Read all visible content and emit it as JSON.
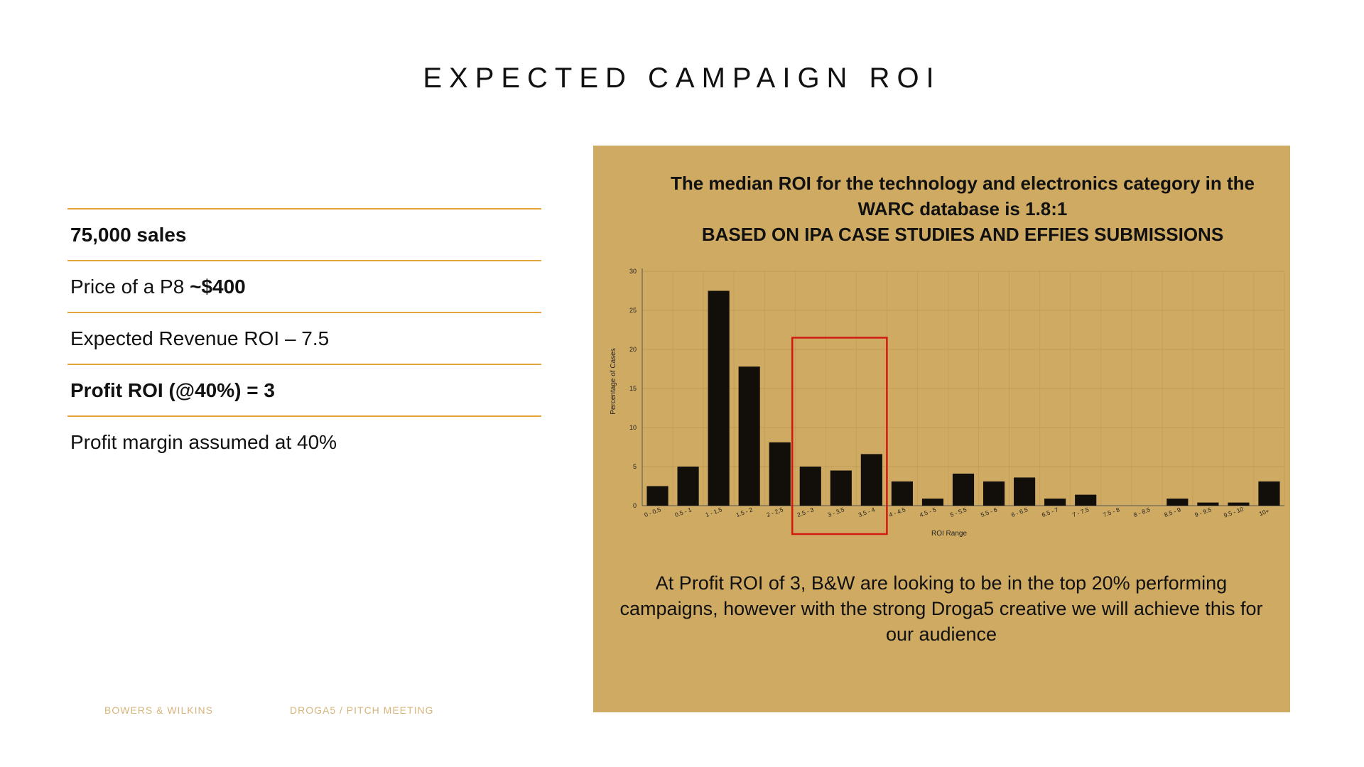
{
  "slide": {
    "title": "EXPECTED CAMPAIGN ROI"
  },
  "stats": [
    {
      "text": "75,000 sales"
    },
    {
      "prefix": "Price of a P8 ",
      "strong": "~$400"
    },
    {
      "text": "Expected Revenue ROI – 7.5"
    },
    {
      "text": "Profit ROI (@40%) = 3"
    },
    {
      "text": "Profit margin assumed at 40%"
    }
  ],
  "footer": {
    "brand": "BOWERS & WILKINS",
    "meeting": "DROGA5 / PITCH MEETING"
  },
  "panel": {
    "heading_line1": "The median ROI for the technology and electronics category in the",
    "heading_line2": "WARC database is 1.8:1",
    "heading_line3": "BASED ON IPA CASE STUDIES AND EFFIES SUBMISSIONS",
    "footnote": "At Profit ROI of 3, B&W are looking to be in the top 20% performing campaigns, however with the strong Droga5 creative we will achieve this for our audience"
  },
  "colors": {
    "accent_line": "#e3a43a",
    "panel_bg": "#cfaa62",
    "bar": "#120e0a",
    "highlight": "#d11a12",
    "footer_text": "#d8b57c"
  },
  "chart_data": {
    "type": "bar",
    "xlabel": "ROI Range",
    "ylabel": "Percentage of Cases",
    "ylim": [
      0,
      30
    ],
    "yticks": [
      0,
      5,
      10,
      15,
      20,
      25,
      30
    ],
    "grid": true,
    "categories": [
      "0 - 0.5",
      "0.5 - 1",
      "1 - 1.5",
      "1.5 - 2",
      "2 - 2.5",
      "2.5 - 3",
      "3 - 3.5",
      "3.5 - 4",
      "4 - 4.5",
      "4.5 - 5",
      "5 - 5.5",
      "5.5 - 6",
      "6 - 6.5",
      "6.5 - 7",
      "7 - 7.5",
      "7.5 - 8",
      "8 - 8.5",
      "8.5 - 9",
      "9 - 9.5",
      "9.5 - 10",
      "10+"
    ],
    "values": [
      2.5,
      5.0,
      27.5,
      17.8,
      8.1,
      5.0,
      4.5,
      6.6,
      3.1,
      0.9,
      4.1,
      3.1,
      3.6,
      0.9,
      1.4,
      0,
      0,
      0.9,
      0.4,
      0.4,
      3.1
    ],
    "highlight": {
      "from_category": "2.5 - 3",
      "to_category": "3.5 - 4",
      "color": "#d11a12"
    }
  }
}
